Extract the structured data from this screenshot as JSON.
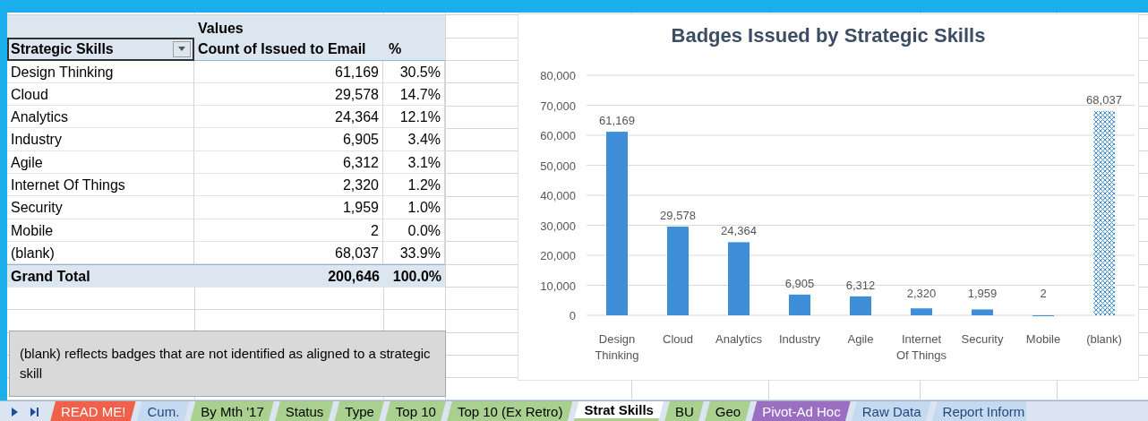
{
  "pivot_table": {
    "values_label": "Values",
    "columns": [
      "Strategic Skills",
      "Count of Issued to Email",
      "%"
    ],
    "rows": [
      {
        "skill": "Design Thinking",
        "count": "61,169",
        "percent": "30.5%"
      },
      {
        "skill": "Cloud",
        "count": "29,578",
        "percent": "14.7%"
      },
      {
        "skill": "Analytics",
        "count": "24,364",
        "percent": "12.1%"
      },
      {
        "skill": "Industry",
        "count": "6,905",
        "percent": "3.4%"
      },
      {
        "skill": "Agile",
        "count": "6,312",
        "percent": "3.1%"
      },
      {
        "skill": "Internet Of Things",
        "count": "2,320",
        "percent": "1.2%"
      },
      {
        "skill": "Security",
        "count": "1,959",
        "percent": "1.0%"
      },
      {
        "skill": "Mobile",
        "count": "2",
        "percent": "0.0%"
      },
      {
        "skill": "(blank)",
        "count": "68,037",
        "percent": "33.9%"
      }
    ],
    "grand_total": {
      "label": "Grand Total",
      "count": "200,646",
      "percent": "100.0%"
    }
  },
  "note": "(blank) reflects badges that are not identified as aligned to a strategic skill",
  "chart": {
    "hatched_bars": [
      false,
      false,
      false,
      false,
      false,
      false,
      false,
      false,
      true
    ],
    "chart_data": {
      "type": "bar",
      "title": "Badges Issued by Strategic Skills",
      "grid": true,
      "categories": [
        "Design Thinking",
        "Cloud",
        "Analytics",
        "Industry",
        "Agile",
        "Internet Of Things",
        "Security",
        "Mobile",
        "(blank)"
      ],
      "series": [
        {
          "color": "#3f8fd8",
          "values": [
            61169,
            29578,
            24364,
            6905,
            6312,
            2320,
            1959,
            2,
            68037
          ]
        }
      ],
      "ylim": [
        0,
        80000
      ],
      "yticks": [
        {
          "value": 0,
          "label": "0"
        },
        {
          "value": 10000,
          "label": "10,000"
        },
        {
          "value": 20000,
          "label": "20,000"
        },
        {
          "value": 30000,
          "label": "30,000"
        },
        {
          "value": 40000,
          "label": "40,000"
        },
        {
          "value": 50000,
          "label": "50,000"
        },
        {
          "value": 60000,
          "label": "60,000"
        },
        {
          "value": 70000,
          "label": "70,000"
        },
        {
          "value": 80000,
          "label": "80,000"
        }
      ],
      "value_labels": [
        "61,169",
        "29,578",
        "24,364",
        "6,905",
        "6,312",
        "2,320",
        "1,959",
        "2",
        "68,037"
      ]
    }
  },
  "sheet_tabs": [
    {
      "label": "READ ME!",
      "color": "#f0604a",
      "selected": false
    },
    {
      "label": "Cum.",
      "color": "#c5d9f1",
      "selected": false
    },
    {
      "label": "By Mth '17",
      "color": "#a9d08e",
      "selected": false
    },
    {
      "label": "Status",
      "color": "#a9d08e",
      "selected": false
    },
    {
      "label": "Type",
      "color": "#a9d08e",
      "selected": false
    },
    {
      "label": "Top 10",
      "color": "#a9d08e",
      "selected": false
    },
    {
      "label": "Top 10 (Ex Retro)",
      "color": "#a9d08e",
      "selected": false
    },
    {
      "label": "Strat Skills",
      "color": "#a9d08e",
      "selected": true
    },
    {
      "label": "BU",
      "color": "#a9d08e",
      "selected": false
    },
    {
      "label": "Geo",
      "color": "#a9d08e",
      "selected": false
    },
    {
      "label": "Pivot-Ad Hoc",
      "color": "#9a6fc2",
      "selected": false
    },
    {
      "label": "Raw Data",
      "color": "#c5d9f1",
      "selected": false
    },
    {
      "label": "Report Inform",
      "color": "#c5d9f1",
      "selected": false
    }
  ]
}
